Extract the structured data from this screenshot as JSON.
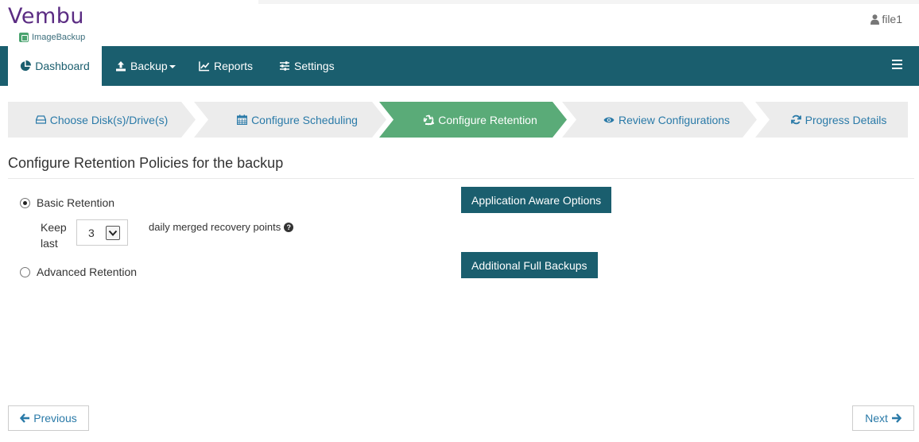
{
  "brand": {
    "logo_word": "Vembu",
    "logo_sub": "ImageBackup"
  },
  "user": {
    "name": "file1",
    "icon": "user-icon"
  },
  "nav": {
    "items": [
      {
        "label": "Dashboard",
        "icon": "dashboard-icon",
        "active": true
      },
      {
        "label": "Backup",
        "icon": "upload-icon",
        "dropdown": true
      },
      {
        "label": "Reports",
        "icon": "line-chart-icon"
      },
      {
        "label": "Settings",
        "icon": "sliders-icon"
      }
    ],
    "menu_icon": "hamburger-icon"
  },
  "wizard": {
    "steps": [
      {
        "label": "Choose Disk(s)/Drive(s)",
        "icon": "drive-icon"
      },
      {
        "label": "Configure Scheduling",
        "icon": "calendar-icon"
      },
      {
        "label": "Configure Retention",
        "icon": "recycle-icon",
        "active": true
      },
      {
        "label": "Review Configurations",
        "icon": "eye-icon"
      },
      {
        "label": "Progress Details",
        "icon": "refresh-icon"
      }
    ]
  },
  "main": {
    "title": "Configure Retention Policies for the backup",
    "basic_retention": "Basic Retention",
    "keep_last": "Keep last",
    "keep_value": "3",
    "daily_text": "daily merged recovery points",
    "advanced_retention": "Advanced Retention",
    "app_aware_btn": "Application Aware Options",
    "additional_full_btn": "Additional Full Backups"
  },
  "footer": {
    "previous": "Previous",
    "next": "Next"
  },
  "colors": {
    "nav_bg": "#1a5e6e",
    "active_step": "#5aab78",
    "link": "#2a7aa8",
    "brand_purple": "#5b2c83"
  }
}
